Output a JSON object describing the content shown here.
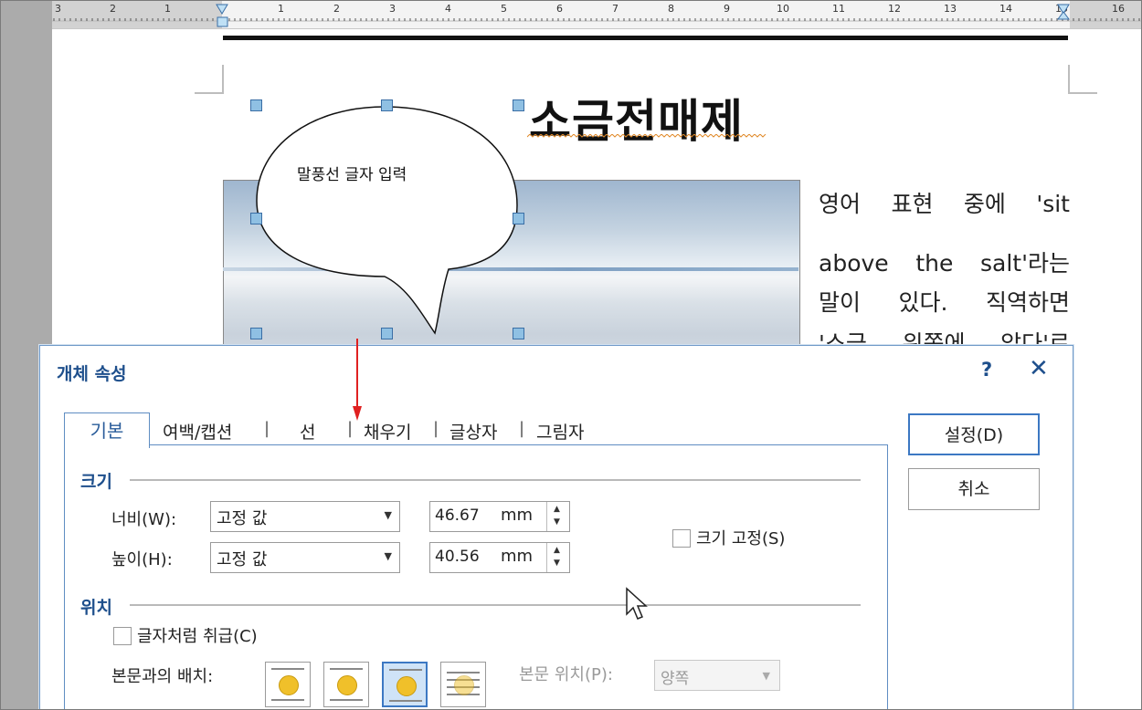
{
  "ruler": {
    "left_numbers": [
      "3",
      "2",
      "1"
    ],
    "right_numbers": [
      "1",
      "2",
      "3",
      "4",
      "5",
      "6",
      "7",
      "8",
      "9",
      "10",
      "11",
      "12",
      "13",
      "14",
      "15",
      "16"
    ]
  },
  "document": {
    "title": "소금전매제",
    "bubble_text": "말풍선 글자 입력",
    "paragraph_lines": [
      "영어 표현 중에 'sit",
      "above the salt'라는",
      "말이 있다. 직역하면",
      "'소금 위쪽에 앉다'로"
    ]
  },
  "dialog": {
    "title": "개체 속성",
    "help_label": "?",
    "close_label": "✕",
    "tabs": [
      "기본",
      "여백/캡션",
      "선",
      "채우기",
      "글상자",
      "그림자"
    ],
    "tab_separator": "|",
    "size_section": "크기",
    "width_label": "너비(W):",
    "height_label": "높이(H):",
    "width_mode": "고정 값",
    "height_mode": "고정 값",
    "width_value": "46.67",
    "height_value": "40.56",
    "unit": "mm",
    "lock_size_label": "크기 고정(S)",
    "position_section": "위치",
    "treat_as_char_label": "글자처럼 취급(C)",
    "wrap_label": "본문과의 배치:",
    "text_position_label": "본문 위치(P):",
    "text_position_value": "양쪽",
    "ok_label": "설정(D)",
    "cancel_label": "취소"
  },
  "colors": {
    "accent": "#1e4f8c",
    "tab_border": "#5f8dc2",
    "arrow": "#e02020",
    "handle": "#8fc0e3"
  }
}
